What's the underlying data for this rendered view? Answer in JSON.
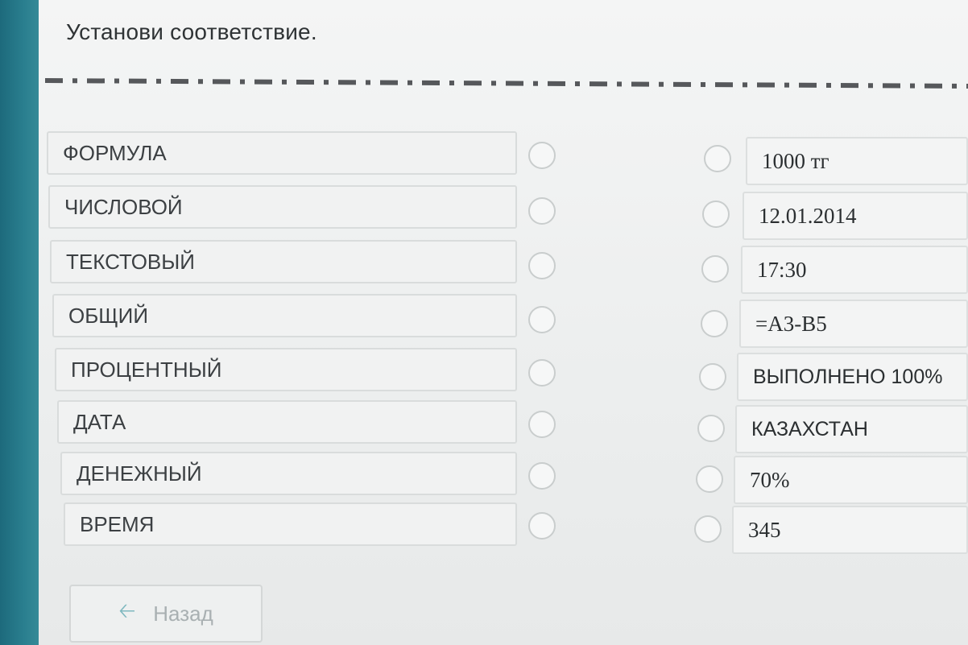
{
  "title": "Установи соответствие.",
  "left_items": [
    "ФОРМУЛА",
    "ЧИСЛОВОЙ",
    "ТЕКСТОВЫЙ",
    "ОБЩИЙ",
    "ПРОЦЕНТНЫЙ",
    "ДАТА",
    "ДЕНЕЖНЫЙ",
    "ВРЕМЯ"
  ],
  "right_items": [
    "1000 тг",
    "12.01.2014",
    "17:30",
    "=А3-В5",
    "ВЫПОЛНЕНО 100%",
    "КАЗАХСТАН",
    "70%",
    "345"
  ],
  "back_button": {
    "label": "Назад",
    "icon": "arrow-left-icon"
  }
}
